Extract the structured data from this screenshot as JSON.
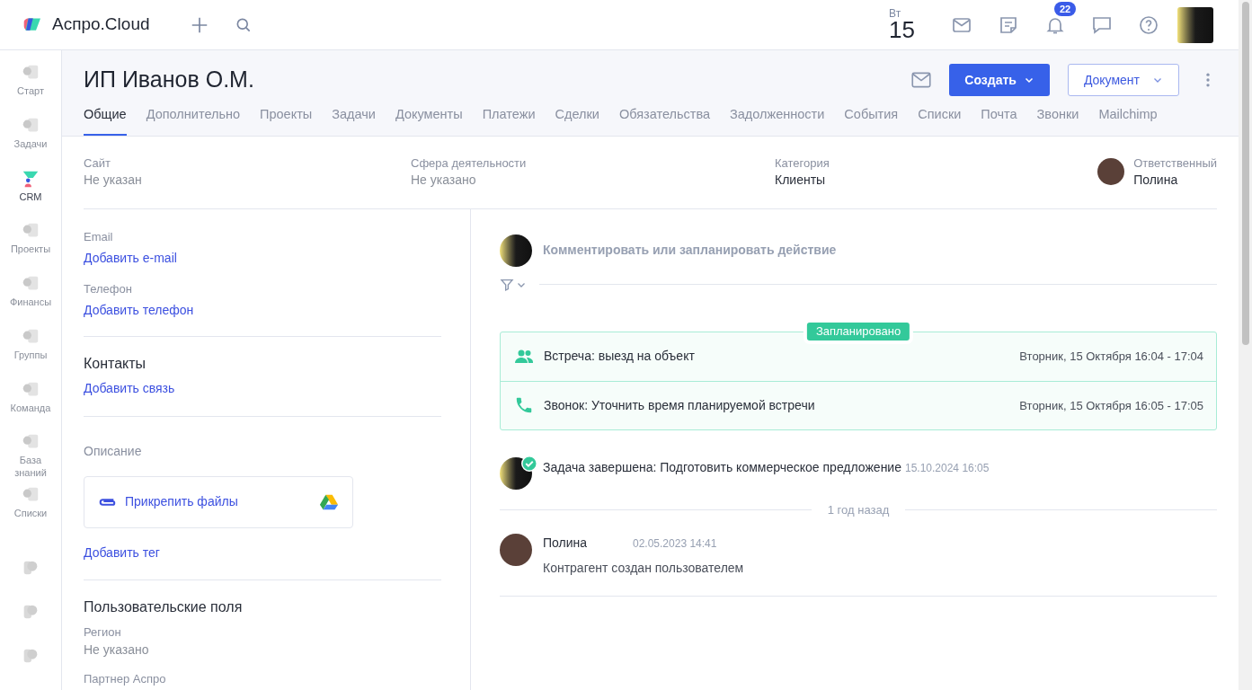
{
  "brand": {
    "name": "Аспро.Cloud"
  },
  "topbar": {
    "weekday": "Вт",
    "day": "15",
    "notifications_count": "22"
  },
  "sidebar": {
    "items": [
      {
        "label": "Старт",
        "selected": false
      },
      {
        "label": "Задачи",
        "selected": false
      },
      {
        "label": "CRM",
        "selected": true
      },
      {
        "label": "Проекты",
        "selected": false
      },
      {
        "label": "Финансы",
        "selected": false
      },
      {
        "label": "Группы",
        "selected": false
      },
      {
        "label": "Команда",
        "selected": false
      },
      {
        "label": "База знаний",
        "selected": false
      },
      {
        "label": "Списки",
        "selected": false
      }
    ]
  },
  "header": {
    "title": "ИП Иванов О.М.",
    "create_button": "Создать",
    "document_button": "Документ"
  },
  "tabs": [
    {
      "label": "Общие",
      "selected": true
    },
    {
      "label": "Дополнительно",
      "selected": false
    },
    {
      "label": "Проекты",
      "selected": false
    },
    {
      "label": "Задачи",
      "selected": false
    },
    {
      "label": "Документы",
      "selected": false
    },
    {
      "label": "Платежи",
      "selected": false
    },
    {
      "label": "Сделки",
      "selected": false
    },
    {
      "label": "Обязательства",
      "selected": false
    },
    {
      "label": "Задолженности",
      "selected": false
    },
    {
      "label": "События",
      "selected": false
    },
    {
      "label": "Списки",
      "selected": false
    },
    {
      "label": "Почта",
      "selected": false
    },
    {
      "label": "Звонки",
      "selected": false
    },
    {
      "label": "Mailchimp",
      "selected": false
    }
  ],
  "fields": [
    {
      "label": "Сайт",
      "value": "Не указан",
      "empty": true,
      "kind": "text"
    },
    {
      "label": "Сфера деятельности",
      "value": "Не указано",
      "empty": true,
      "kind": "text"
    },
    {
      "label": "Категория",
      "value": "Клиенты",
      "empty": false,
      "kind": "text"
    },
    {
      "label": "Ответственный",
      "value": "Полина",
      "empty": false,
      "kind": "user"
    }
  ],
  "left": {
    "email": {
      "label": "Email",
      "link": "Добавить e-mail"
    },
    "phone": {
      "label": "Телефон",
      "link": "Добавить телефон"
    },
    "contacts": {
      "heading": "Контакты",
      "link": "Добавить связь"
    },
    "description_label": "Описание",
    "attach_label": "Прикрепить файлы",
    "tag_link": "Добавить тег",
    "custom_fields": {
      "heading": "Пользовательские поля",
      "items": [
        {
          "label": "Регион",
          "value": "Не указано"
        },
        {
          "label": "Партнер Аспро"
        }
      ]
    }
  },
  "feed": {
    "comment_placeholder": "Комментировать или запланировать действие",
    "planned": {
      "badge": "Запланировано",
      "items": [
        {
          "kind": "meeting",
          "title": "Встреча: выезд на объект",
          "time": "Вторник, 15 Октября 16:04 - 17:04"
        },
        {
          "kind": "call",
          "title": "Звонок: Уточнить время планируемой встречи",
          "time": "Вторник, 15 Октября 16:05 - 17:05"
        }
      ]
    },
    "events": [
      {
        "kind": "task",
        "text": "Задача завершена: Подготовить коммерческое предложение",
        "time": "15.10.2024 16:05"
      },
      {
        "kind": "divider",
        "text": "1 год назад"
      },
      {
        "kind": "comment",
        "author": "Полина",
        "time": "02.05.2023 14:41",
        "text": "Контрагент создан пользователем"
      }
    ]
  }
}
